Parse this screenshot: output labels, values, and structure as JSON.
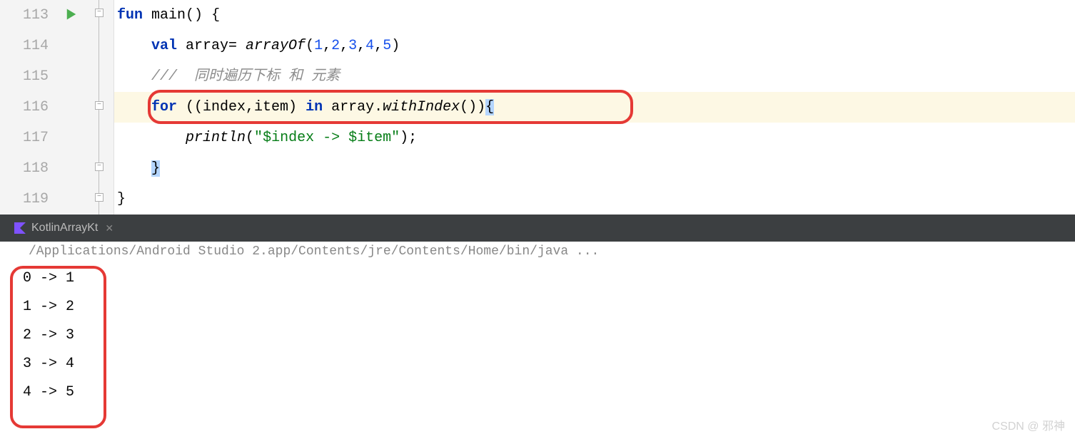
{
  "gutter": {
    "lines": [
      "113",
      "114",
      "115",
      "116",
      "117",
      "118",
      "119"
    ]
  },
  "code": {
    "l113": {
      "kw1": "fun",
      "fn": "main",
      "paren": "()",
      "brace": " {"
    },
    "l114": {
      "indent": "    ",
      "kw": "val",
      "var": " array= ",
      "fn": "arrayOf",
      "po": "(",
      "n1": "1",
      "c1": ",",
      "n2": "2",
      "c2": ",",
      "n3": "3",
      "c3": ",",
      "n4": "4",
      "c4": ",",
      "n5": "5",
      "pc": ")"
    },
    "l115": {
      "indent": "    ",
      "comment": "///  同时遍历下标 和 元素"
    },
    "l116": {
      "indent": "    ",
      "kw1": "for",
      "open": " ((index,item) ",
      "kw2": "in",
      "mid": " array.",
      "fn": "withIndex",
      "close": "())",
      "brace": "{"
    },
    "l117": {
      "indent": "        ",
      "fn": "println",
      "po": "(",
      "str1": "\"",
      "tpl1": "$index",
      "str2": " -> ",
      "tpl2": "$item",
      "str3": "\"",
      "pc": ")",
      "semi": ";"
    },
    "l118": {
      "indent": "    ",
      "brace": "}"
    },
    "l119": {
      "brace": "}"
    }
  },
  "tab": {
    "name": "KotlinArrayKt",
    "close": "✕"
  },
  "console": {
    "path": "/Applications/Android Studio 2.app/Contents/jre/Contents/Home/bin/java ...",
    "lines": [
      "0 -> 1",
      "1 -> 2",
      "2 -> 3",
      "3 -> 4",
      "4 -> 5"
    ]
  },
  "watermark": "CSDN @ 邪神"
}
